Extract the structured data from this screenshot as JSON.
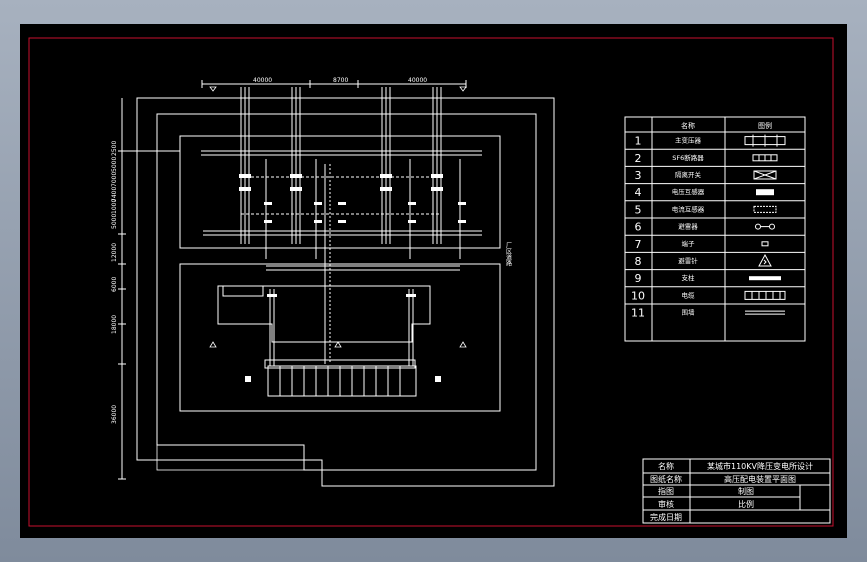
{
  "drawing": {
    "dims_top": [
      "40000",
      "8700",
      "40000"
    ],
    "dims_left": [
      "2500",
      "5000",
      "7000",
      "7400",
      "1000",
      "5000",
      "12000",
      "6000",
      "18000",
      "36000"
    ],
    "side_label": "厂区道路"
  },
  "legend": {
    "headers": [
      "名称",
      "图例"
    ],
    "rows": [
      {
        "no": "1",
        "name": "主变压器"
      },
      {
        "no": "2",
        "name": "SF6断路器"
      },
      {
        "no": "3",
        "name": "隔离开关"
      },
      {
        "no": "4",
        "name": "电压互感器"
      },
      {
        "no": "5",
        "name": "电流互感器"
      },
      {
        "no": "6",
        "name": "避雷器"
      },
      {
        "no": "7",
        "name": "端子"
      },
      {
        "no": "8",
        "name": "避雷针"
      },
      {
        "no": "9",
        "name": "支柱"
      },
      {
        "no": "10",
        "name": "电缆"
      },
      {
        "no": "11",
        "name": "围墙"
      }
    ]
  },
  "title_block": {
    "name_label": "名称",
    "name_value": "某城市110KV降压变电所设计",
    "drawing_label": "图纸名称",
    "drawing_value": "高压配电装置平面图",
    "drawn_label": "指图",
    "drawn_value": "制图",
    "check_label": "审核",
    "scale_label": "比例",
    "date_label": "完成日期"
  }
}
